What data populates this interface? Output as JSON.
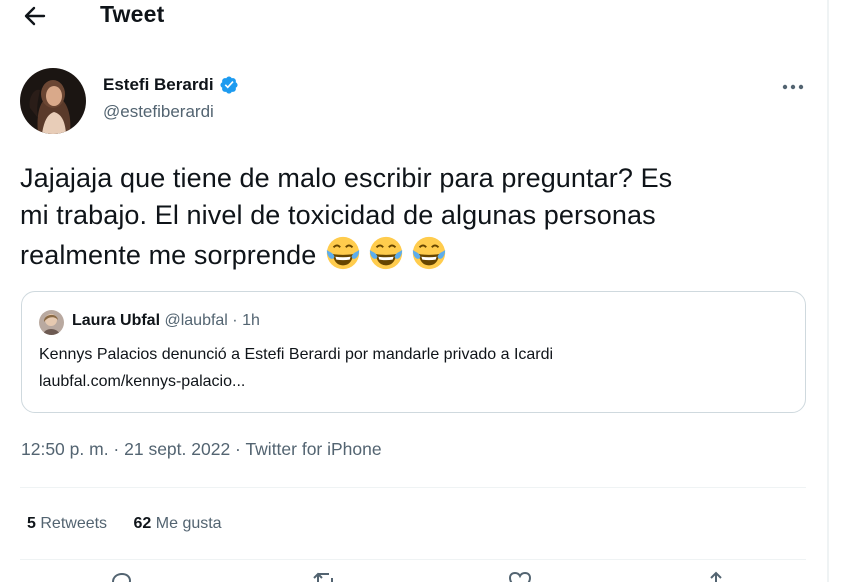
{
  "header": {
    "title": "Tweet"
  },
  "author": {
    "name": "Estefi Berardi",
    "handle": "@estefiberardi",
    "verified": true
  },
  "tweet": {
    "line1": "Jajajaja que tiene de malo escribir para preguntar? Es",
    "line2": "mi trabajo.  El nivel de toxicidad de algunas personas",
    "line3": "realmente me sorprende",
    "emojis": [
      "face-with-tears-of-joy",
      "face-with-tears-of-joy",
      "face-with-tears-of-joy"
    ]
  },
  "quote": {
    "name": "Laura Ubfal",
    "handle": "@laubfal",
    "time": " · 1h",
    "text": "Kennys Palacios denunció a Estefi Berardi por mandarle privado a Icardi",
    "link": "laubfal.com/kennys-palacio..."
  },
  "meta": {
    "time": "12:50 p. m.",
    "sep1": " · ",
    "date": "21 sept. 2022",
    "sep2": " · ",
    "source": "Twitter for iPhone"
  },
  "stats": {
    "retweets_count": "5",
    "retweets_label": "Retweets",
    "likes_count": "62",
    "likes_label": "Me gusta"
  },
  "colors": {
    "accent": "#1d9bf0",
    "secondary_text": "#536471",
    "border": "#cfd9de"
  },
  "icons": [
    "back-arrow-icon",
    "verified-badge-icon",
    "more-options-icon",
    "reply-icon",
    "retweet-icon",
    "like-icon",
    "share-icon"
  ]
}
